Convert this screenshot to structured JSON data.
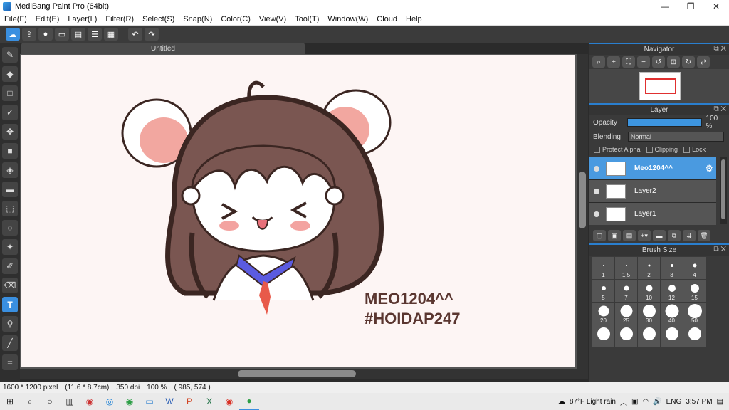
{
  "window": {
    "title": "MediBang Paint Pro (64bit)",
    "controls": [
      "—",
      "❐",
      "✕"
    ]
  },
  "menu": [
    "File(F)",
    "Edit(E)",
    "Layer(L)",
    "Filter(R)",
    "Select(S)",
    "Snap(N)",
    "Color(C)",
    "View(V)",
    "Tool(T)",
    "Window(W)",
    "Cloud",
    "Help"
  ],
  "document": {
    "tab_title": "Untitled"
  },
  "canvas_text": {
    "line1": "MEO1204^^",
    "line2": "#HOIDAP247"
  },
  "status": {
    "size": "1600 * 1200 pixel",
    "physical": "(11.6 * 8.7cm)",
    "dpi": "350 dpi",
    "zoom": "100 %",
    "cursor": "( 985, 574 )"
  },
  "navigator": {
    "title": "Navigator"
  },
  "layer_panel": {
    "title": "Layer",
    "opacity_label": "Opacity",
    "opacity_value": "100 %",
    "opacity": 1.0,
    "blending_label": "Blending",
    "blending_value": "Normal",
    "protect_alpha": "Protect Alpha",
    "clipping": "Clipping",
    "lock": "Lock",
    "layers": [
      {
        "name": "Meo1204^^",
        "selected": true
      },
      {
        "name": "Layer2",
        "selected": false
      },
      {
        "name": "Layer1",
        "selected": false
      }
    ]
  },
  "brush_size": {
    "title": "Brush Size",
    "sizes": [
      "1",
      "1.5",
      "2",
      "3",
      "4",
      "5",
      "7",
      "10",
      "12",
      "15",
      "20",
      "25",
      "30",
      "40",
      "50",
      "",
      "",
      "",
      "",
      ""
    ]
  },
  "taskbar": {
    "weather": "87°F Light rain",
    "lang": "ENG",
    "time": "3:57 PM"
  }
}
